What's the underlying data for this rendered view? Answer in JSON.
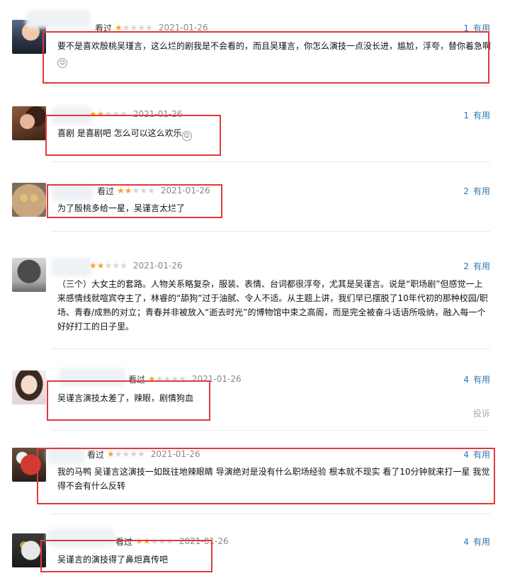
{
  "reviews": [
    {
      "status": "看过",
      "stars": 1,
      "date": "2021-01-26",
      "votes": "1",
      "vote_label": "有用",
      "text": "要不是喜欢殷桃吴瑾言，这么烂的剧我是不会看的，而且吴瑾言，你怎么演技一点没长进，尴尬，浮夸，替你着急啊"
    },
    {
      "status": "",
      "stars": 2,
      "date": "2021-01-26",
      "votes": "1",
      "vote_label": "有用",
      "text": "喜剧 是喜剧吧 怎么可以这么欢乐"
    },
    {
      "status": "看过",
      "stars": 2,
      "date": "2021-01-26",
      "votes": "2",
      "vote_label": "有用",
      "text": "为了殷桃多给一星，吴谨言太烂了"
    },
    {
      "status": "",
      "stars": 2,
      "date": "2021-01-26",
      "votes": "2",
      "vote_label": "有用",
      "text": "（三个）大女主的套路。人物关系略复杂，服装、表情、台词都很浮夸，尤其是吴谨言。说是“职场剧”但感觉一上来感情线就喧宾夺主了，林睿的“舔狗”过于油腻、令人不适。从主题上讲，我们早已摆脱了10年代初的那种校园/职场、青春/成熟的对立；青春并非被放入“逝去时光”的博物馆中束之高阁，而是完全被奋斗话语所吸纳，融入每一个好好打工的日子里。"
    },
    {
      "status": "看过",
      "stars": 1,
      "date": "2021-01-26",
      "votes": "4",
      "vote_label": "有用",
      "text": "吴谨言演技太差了，辣眼，剧情狗血",
      "report": "投诉"
    },
    {
      "status": "看过",
      "stars": 1,
      "date": "2021-01-26",
      "votes": "4",
      "vote_label": "有用",
      "text": "我的马鸭 吴谨言这演技一如既往地辣眼睛 导演绝对是没有什么职场经验 根本就不现实 看了10分钟就来打一星 我觉得不会有什么反转"
    },
    {
      "status": "看过",
      "stars": 2,
      "date": "2021-01-26",
      "votes": "4",
      "vote_label": "有用",
      "text": "吴谨言的演技得了鼻炟真传吧"
    }
  ]
}
